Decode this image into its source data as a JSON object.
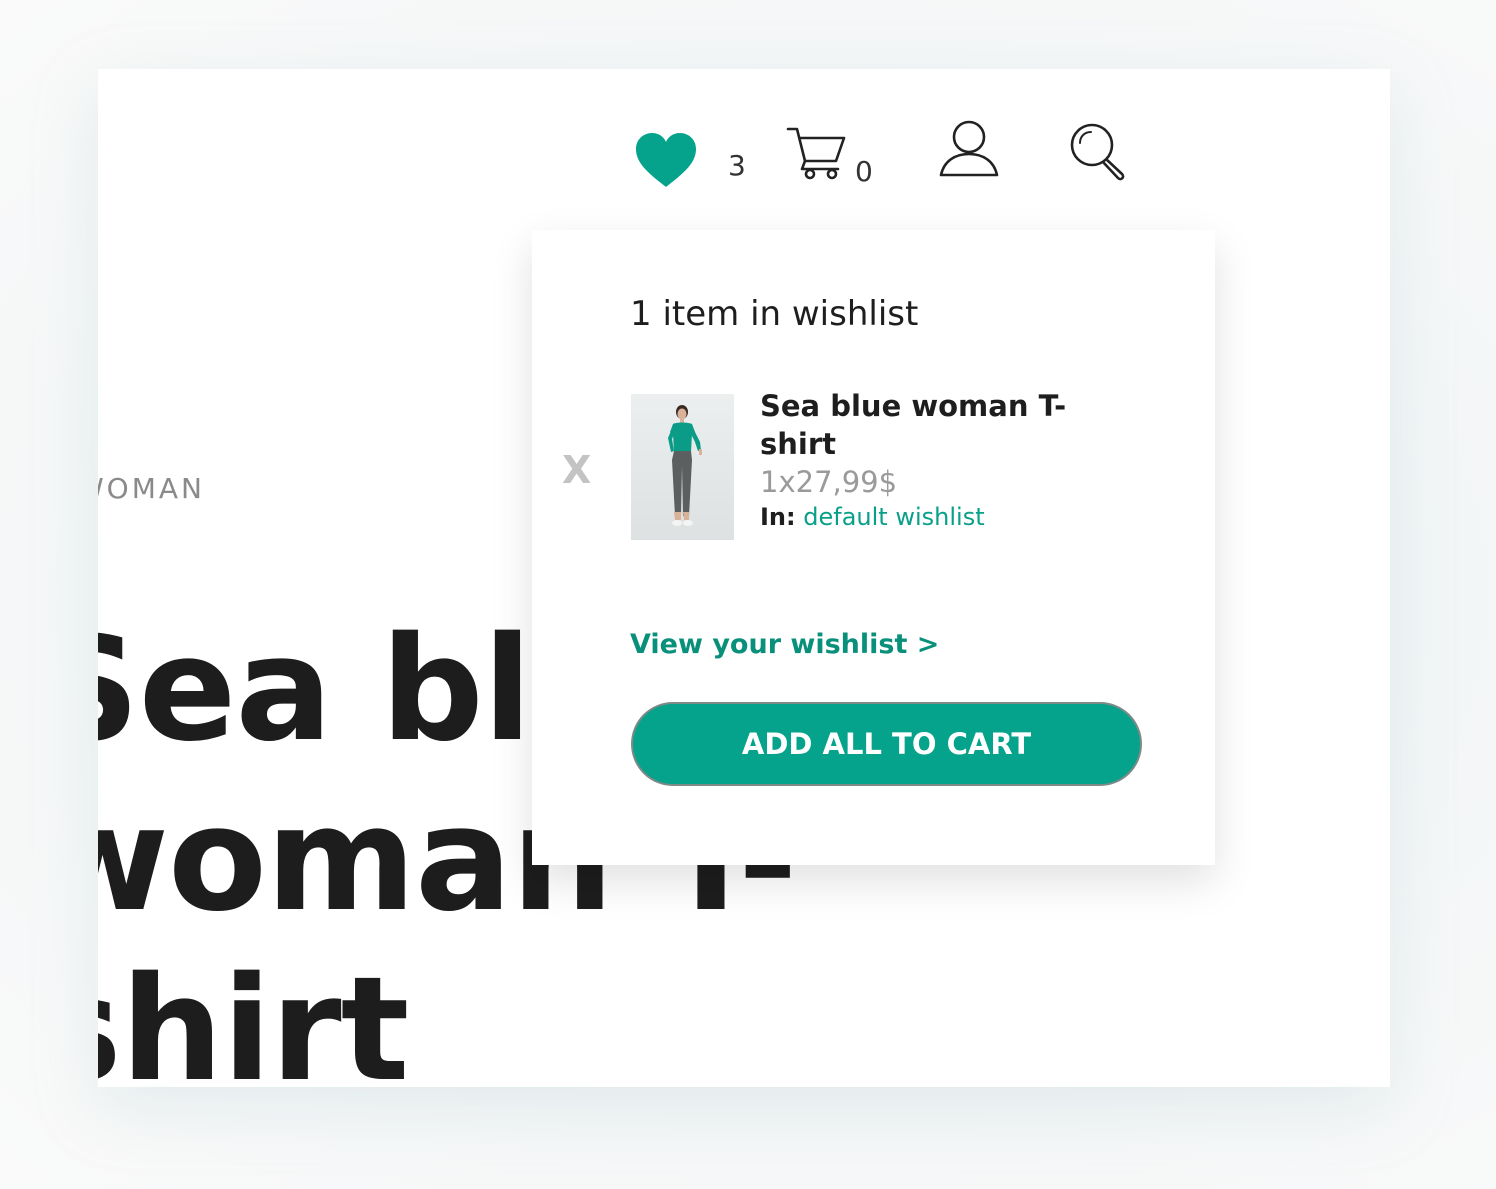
{
  "product": {
    "category": "WOMAN",
    "title": "Sea blue woman T-shirt"
  },
  "header": {
    "wishlist_count": "3",
    "cart_count": "0",
    "icons": [
      "heart-icon",
      "cart-icon",
      "user-icon",
      "search-icon"
    ],
    "accent_color": "#05a38b"
  },
  "wishlist_dropdown": {
    "heading": "1 item in wishlist",
    "items": [
      {
        "remove_label": "X",
        "name": "Sea blue woman T-shirt",
        "price": "1x27,99$",
        "in_label": "In:",
        "in_value": "default wishlist"
      }
    ],
    "view_link": "View your wishlist >",
    "add_all_button": "ADD ALL TO CART"
  }
}
